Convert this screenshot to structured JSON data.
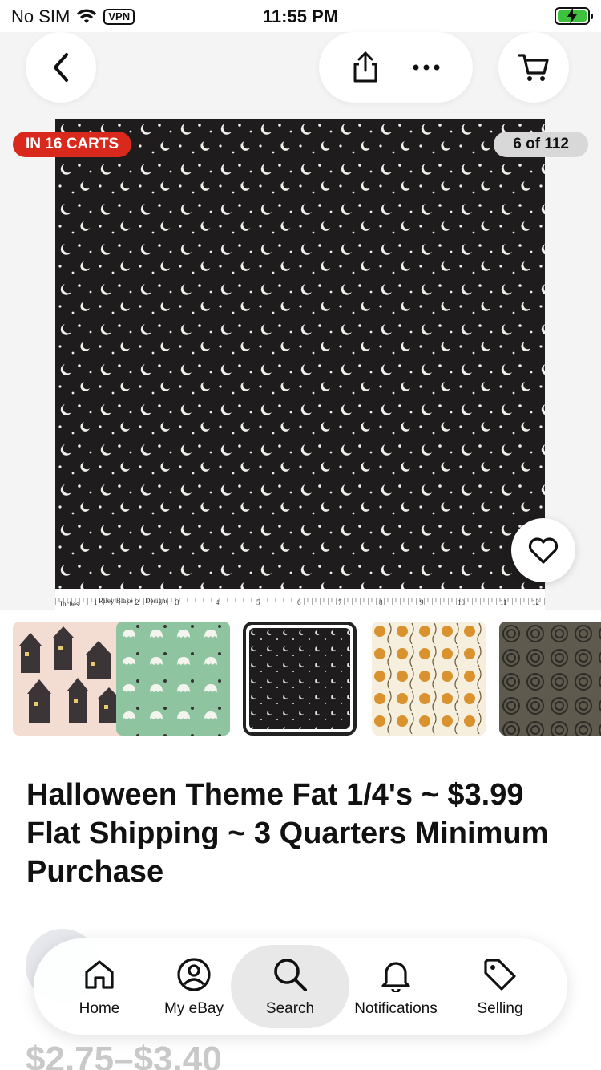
{
  "status_bar": {
    "carrier": "No SIM",
    "vpn_label": "VPN",
    "time": "11:55 PM"
  },
  "top_nav": {
    "back_icon": "chevron-left-icon",
    "share_icon": "share-icon",
    "more_icon": "more-icon",
    "cart_icon": "cart-icon"
  },
  "gallery": {
    "carts_badge": "IN 16 CARTS",
    "image_counter": "6 of 112",
    "ruler_labels": [
      "Inches",
      "1",
      "Riley Blake",
      "2",
      "Designs",
      "3",
      "4",
      "5",
      "6",
      "7",
      "8",
      "9",
      "10",
      "11",
      "12"
    ]
  },
  "thumbnails": [
    {
      "name": "thumb-houses"
    },
    {
      "name": "thumb-ghosts"
    },
    {
      "name": "thumb-moons",
      "selected": true
    },
    {
      "name": "thumb-pumpkins"
    },
    {
      "name": "thumb-spirals"
    }
  ],
  "product": {
    "title": "Halloween Theme Fat 1/4's ~ $3.99 Flat Shipping ~ 3 Quarters Minimum Purchase",
    "price_partial": "$2.75–$3.40"
  },
  "tabbar": {
    "items": [
      {
        "label": "Home",
        "icon": "home-icon"
      },
      {
        "label": "My eBay",
        "icon": "user-icon"
      },
      {
        "label": "Search",
        "icon": "search-icon",
        "active": true
      },
      {
        "label": "Notifications",
        "icon": "bell-icon"
      },
      {
        "label": "Selling",
        "icon": "tag-icon"
      }
    ]
  },
  "colors": {
    "badge_red": "#d9291c",
    "fabric_dark": "#1e1c1d",
    "accent_green": "#3ec23e"
  }
}
